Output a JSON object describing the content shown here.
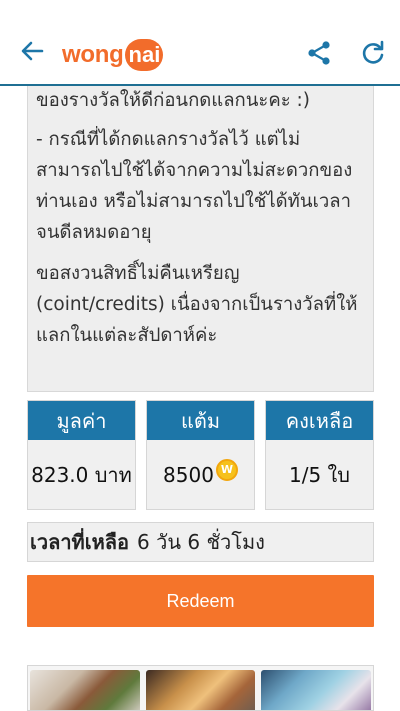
{
  "header": {
    "logo_main": "wong",
    "logo_badge": "nai",
    "back_icon": "back-arrow-icon",
    "share_icon": "share-icon",
    "refresh_icon": "refresh-icon"
  },
  "notes": {
    "line1": "ของรางวัลให้ดีก่อนกดแลกนะคะ :)",
    "para2": "- กรณีที่ได้กดแลกรางวัลไว้ แต่ไม่สามารถไปใช้ได้จากความไม่สะดวกของท่านเอง หรือไม่สามารถไปใช้ได้ทันเวลาจนดีลหมดอายุ",
    "para3": "ขอสงวนสิทธิ์ไม่คืนเหรียญ (coint/credits) เนื่องจากเป็นรางวัลที่ให้แลกในแต่ละสัปดาห์ค่ะ"
  },
  "stats": [
    {
      "label": "มูลค่า",
      "value": "823.0 บาท"
    },
    {
      "label": "แต้ม",
      "value": "8500",
      "icon": "coin-icon",
      "icon_glyph": "W"
    },
    {
      "label": "คงเหลือ",
      "value": "1/5 ใบ"
    }
  ],
  "time_remaining": {
    "label": "เวลาที่เหลือ",
    "value": "6 วัน 6 ชั่วโมง"
  },
  "redeem_label": "Redeem",
  "colors": {
    "brand_orange": "#f5742a",
    "header_blue": "#1d76a8",
    "coin_gold": "#f6c11c"
  }
}
